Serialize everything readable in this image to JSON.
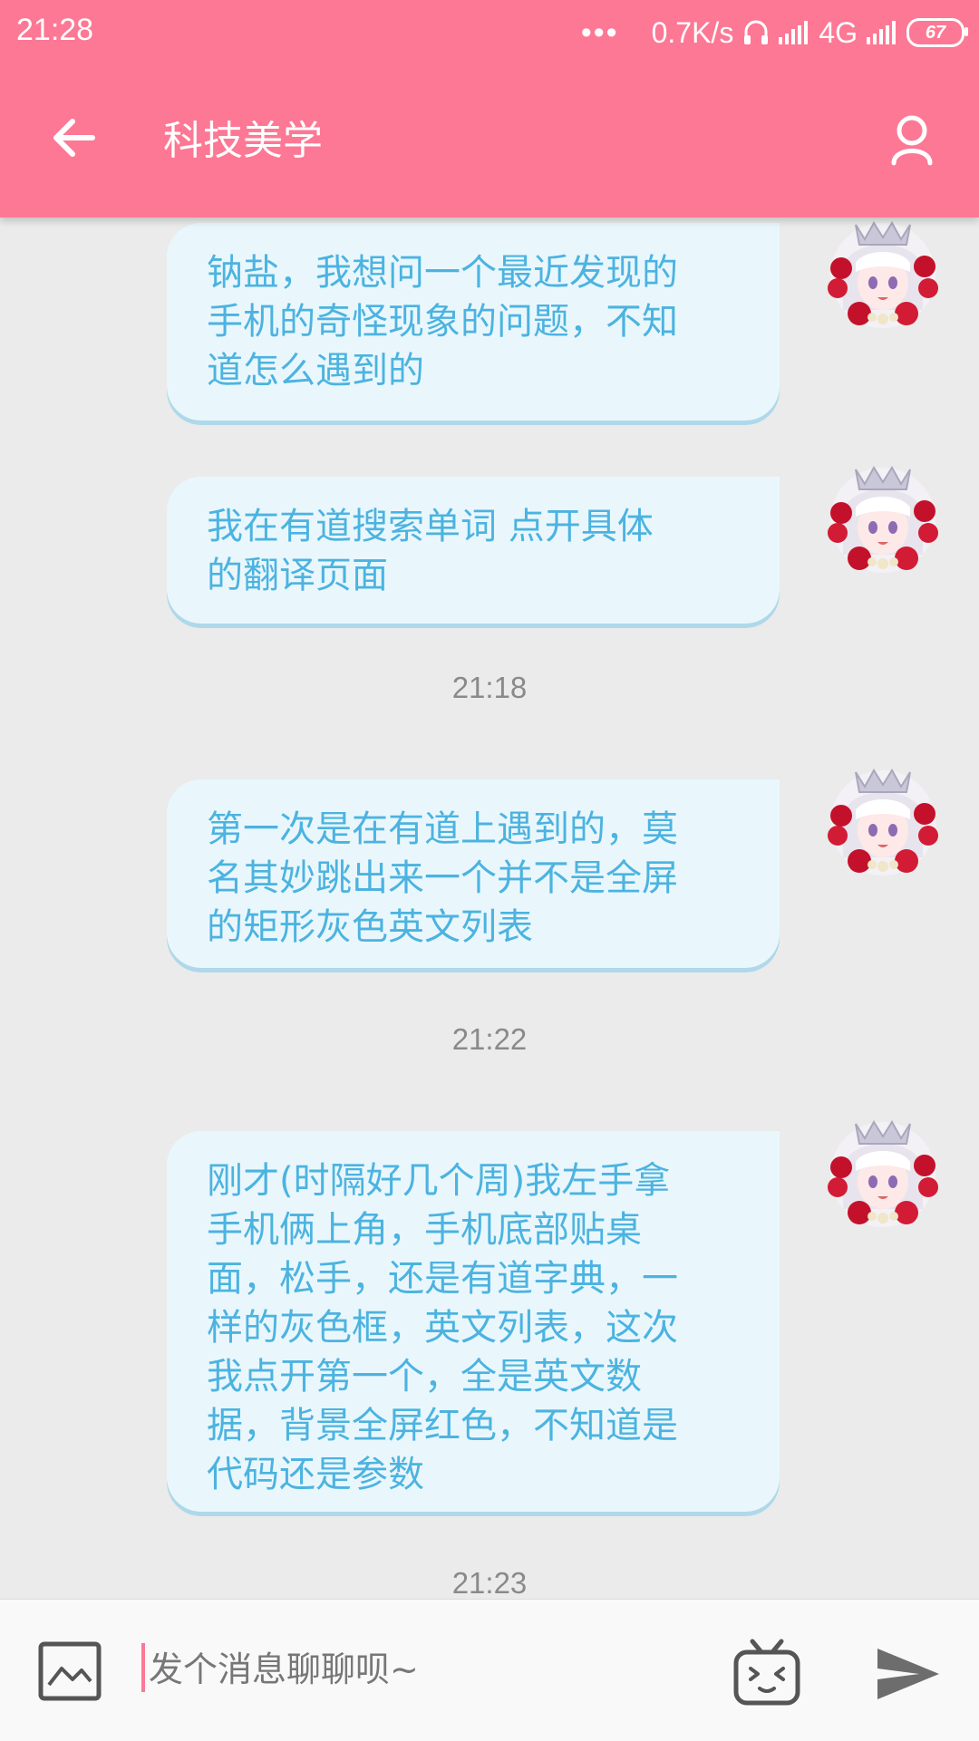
{
  "status_bar": {
    "time": "21:28",
    "dots": "•••",
    "speed": "0.7K/s",
    "network": "4G",
    "battery": "67"
  },
  "app_bar": {
    "title": "科技美学",
    "back_icon": "arrow-left-icon",
    "profile_icon": "person-icon"
  },
  "messages": [
    {
      "type": "bubble",
      "text": "钠盐，我想问一个最近发现的\n手机的奇怪现象的问题，不知\n道怎么遇到的"
    },
    {
      "type": "bubble",
      "text": "我在有道搜索单词 点开具体\n的翻译页面"
    },
    {
      "type": "time",
      "text": "21:18"
    },
    {
      "type": "bubble",
      "text": "第一次是在有道上遇到的，莫\n名其妙跳出来一个并不是全屏\n的矩形灰色英文列表"
    },
    {
      "type": "time",
      "text": "21:22"
    },
    {
      "type": "bubble",
      "text": "刚才(时隔好几个周)我左手拿\n手机俩上角，手机底部贴桌\n面，松手，还是有道字典，一\n样的灰色框，英文列表，这次\n我点开第一个，全是英文数\n据，背景全屏红色，不知道是\n代码还是参数"
    },
    {
      "type": "time",
      "text": "21:23"
    }
  ],
  "input_bar": {
    "placeholder": "发个消息聊聊呗~",
    "image_icon": "image-icon",
    "emoji_icon": "tv-face-icon",
    "send_icon": "send-icon"
  },
  "colors": {
    "accent": "#fd7894",
    "bubble_bg": "#e9f7fd",
    "bubble_text": "#4cb3e0",
    "chat_bg": "#ebebeb"
  }
}
